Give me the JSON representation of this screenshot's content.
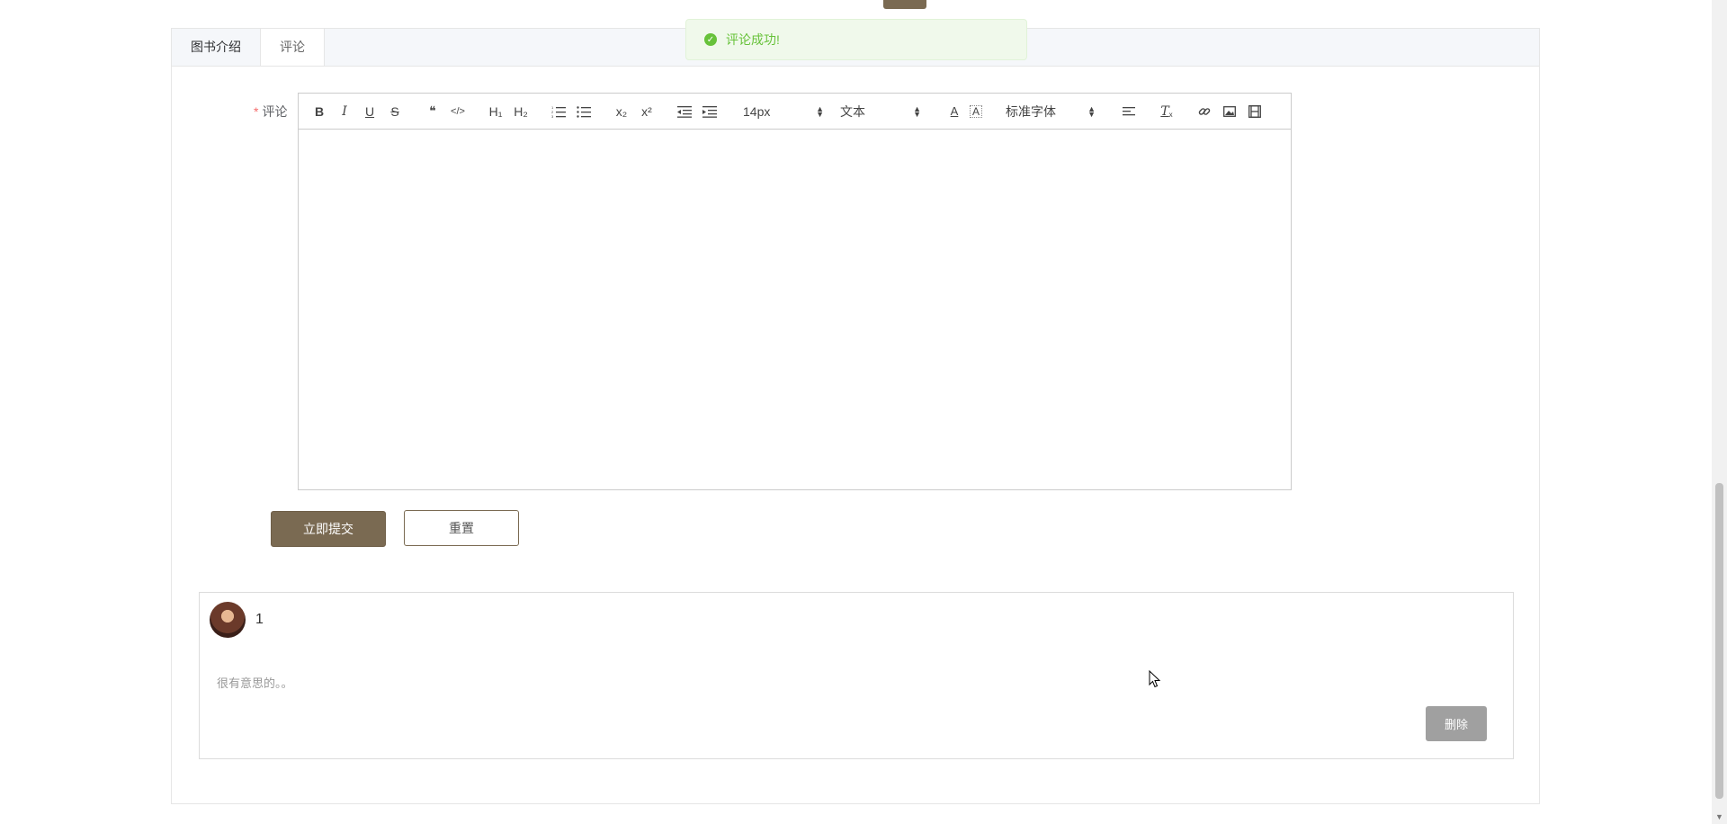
{
  "tabs": [
    {
      "label": "图书介绍",
      "active": false
    },
    {
      "label": "评论",
      "active": true
    }
  ],
  "toast": {
    "message": "评论成功!"
  },
  "form": {
    "required_mark": "*",
    "label": "评论"
  },
  "toolbar": {
    "font_size": "14px",
    "header": "文本",
    "font_family": "标准字体",
    "h1": "H₁",
    "h2": "H₂",
    "sub": "x₂",
    "sup": "x²"
  },
  "buttons": {
    "submit": "立即提交",
    "reset": "重置",
    "delete": "删除"
  },
  "comment": {
    "username": "1",
    "text": "很有意思的。。"
  },
  "colors": {
    "brand": "#7a6a52",
    "toast_success": "#67c23a"
  }
}
